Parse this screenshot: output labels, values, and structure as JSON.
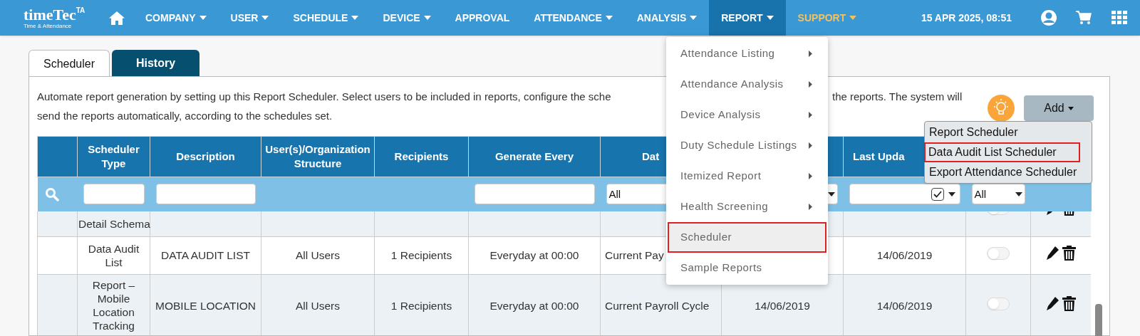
{
  "logo": {
    "name": "timeTec",
    "badge": "TA",
    "tagline": "Time & Attendance"
  },
  "nav": [
    {
      "label": "COMPANY",
      "dropdown": true,
      "selected": false,
      "color": "#ffffff"
    },
    {
      "label": "USER",
      "dropdown": true,
      "selected": false,
      "color": "#ffffff"
    },
    {
      "label": "SCHEDULE",
      "dropdown": true,
      "selected": false,
      "color": "#ffffff"
    },
    {
      "label": "DEVICE",
      "dropdown": true,
      "selected": false,
      "color": "#ffffff"
    },
    {
      "label": "APPROVAL",
      "dropdown": false,
      "selected": false,
      "color": "#ffffff"
    },
    {
      "label": "ATTENDANCE",
      "dropdown": true,
      "selected": false,
      "color": "#ffffff"
    },
    {
      "label": "ANALYSIS",
      "dropdown": true,
      "selected": false,
      "color": "#ffffff"
    },
    {
      "label": "REPORT",
      "dropdown": true,
      "selected": true,
      "color": "#ffffff"
    },
    {
      "label": "SUPPORT",
      "dropdown": true,
      "selected": false,
      "color": "#f7c15a"
    }
  ],
  "datetime": "15 APR 2025, 08:51",
  "tabs": [
    {
      "label": "Scheduler",
      "selected": true
    },
    {
      "label": "History",
      "selected": false
    }
  ],
  "description": [
    "Automate report generation by setting up this Report Scheduler. Select users to be included in reports, configure the sche",
    "the reports. The system will",
    "send the reports automatically, according to the schedules set."
  ],
  "add_button": {
    "label": "Add"
  },
  "add_menu": [
    {
      "label": "Report Scheduler",
      "highlighted": false
    },
    {
      "label": "Data Audit List Scheduler",
      "highlighted": true
    },
    {
      "label": "Export Attendance Scheduler",
      "highlighted": false
    }
  ],
  "report_menu": [
    {
      "label": "Attendance Listing",
      "submenu": true,
      "highlighted": false
    },
    {
      "label": "Attendance Analysis",
      "submenu": true,
      "highlighted": false
    },
    {
      "label": "Device Analysis",
      "submenu": true,
      "highlighted": false
    },
    {
      "label": "Duty Schedule Listings",
      "submenu": true,
      "highlighted": false
    },
    {
      "label": "Itemized Report",
      "submenu": true,
      "highlighted": false
    },
    {
      "label": "Health Screening",
      "submenu": true,
      "highlighted": false
    },
    {
      "label": "Scheduler",
      "submenu": false,
      "highlighted": true
    },
    {
      "label": "Sample Reports",
      "submenu": false,
      "highlighted": false
    }
  ],
  "table": {
    "columns": [
      null,
      "Scheduler Type",
      "Description",
      "User(s)/Organization Structure",
      "Recipients",
      "Generate Every",
      "Dat",
      null,
      "Last Upda",
      null,
      null
    ],
    "filters": [
      {
        "kind": "search"
      },
      {
        "kind": "input"
      },
      {
        "kind": "input"
      },
      {
        "kind": "none"
      },
      {
        "kind": "none"
      },
      {
        "kind": "input"
      },
      {
        "kind": "select",
        "value": "All"
      },
      {
        "kind": "select"
      },
      {
        "kind": "check",
        "checked": true
      },
      {
        "kind": "select",
        "value": "All"
      },
      {
        "kind": "none"
      }
    ],
    "rows": [
      {
        "cells": [
          null,
          "Detail Schema",
          null,
          null,
          null,
          null,
          null,
          null,
          null
        ],
        "enabled": false
      },
      {
        "cells": [
          null,
          "Data Audit List",
          "DATA AUDIT LIST",
          "All Users",
          "1 Recipients",
          "Everyday at 00:00",
          "Current Pay",
          null,
          "14/06/2019"
        ],
        "enabled": false
      },
      {
        "cells": [
          null,
          "Report – Mobile Location Tracking",
          "MOBILE LOCATION",
          "All Users",
          "1 Recipients",
          "Everyday at 00:00",
          "Current Payroll Cycle",
          "14/06/2019",
          "14/06/2019"
        ],
        "enabled": false
      }
    ]
  }
}
